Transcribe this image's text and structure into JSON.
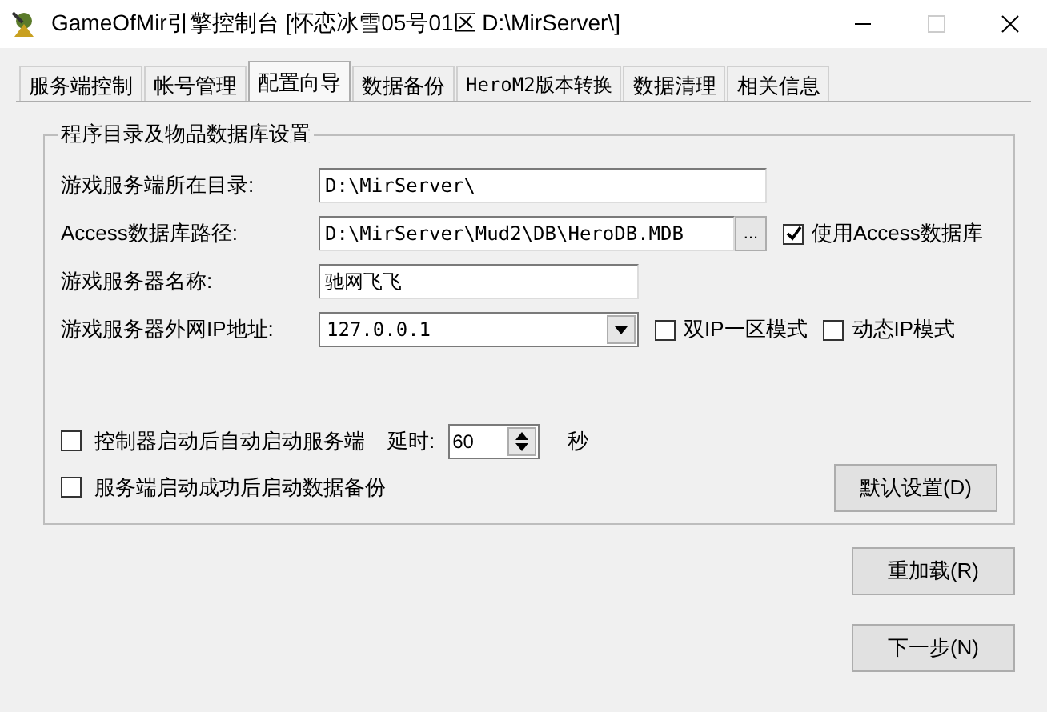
{
  "window": {
    "title": "GameOfMir引擎控制台 [怀恋冰雪05号01区 D:\\MirServer\\]"
  },
  "tabs": [
    {
      "label": "服务端控制",
      "selected": false
    },
    {
      "label": "帐号管理",
      "selected": false
    },
    {
      "label": "配置向导",
      "selected": true
    },
    {
      "label": "数据备份",
      "selected": false
    },
    {
      "label": "HeroM2版本转换",
      "selected": false
    },
    {
      "label": "数据清理",
      "selected": false
    },
    {
      "label": "相关信息",
      "selected": false
    }
  ],
  "group": {
    "title": "程序目录及物品数据库设置",
    "fields": [
      {
        "kind": "text",
        "label": "游戏服务端所在目录:",
        "value": "D:\\MirServer\\"
      },
      {
        "kind": "browse",
        "label": "Access数据库路径:",
        "value": "D:\\MirServer\\Mud2\\DB\\HeroDB.MDB",
        "button": "...",
        "options": [
          {
            "label": "使用Access数据库",
            "checked": true
          }
        ]
      },
      {
        "kind": "text",
        "label": "游戏服务器名称:",
        "value": "驰网飞飞"
      },
      {
        "kind": "combo",
        "label": "游戏服务器外网IP地址:",
        "value": "127.0.0.1",
        "options": [
          {
            "label": "双IP一区模式",
            "checked": false
          },
          {
            "label": "动态IP模式",
            "checked": false
          }
        ]
      }
    ],
    "startup": [
      {
        "kind": "delay",
        "label": "控制器启动后自动启动服务端",
        "checked": false,
        "delay_label": "延时:",
        "delay_value": "60",
        "unit": "秒"
      },
      {
        "kind": "plain",
        "label": "服务端启动成功后启动数据备份",
        "checked": false
      }
    ],
    "default_button": "默认设置(D)"
  },
  "buttons": [
    "重加载(R)",
    "下一步(N)"
  ]
}
